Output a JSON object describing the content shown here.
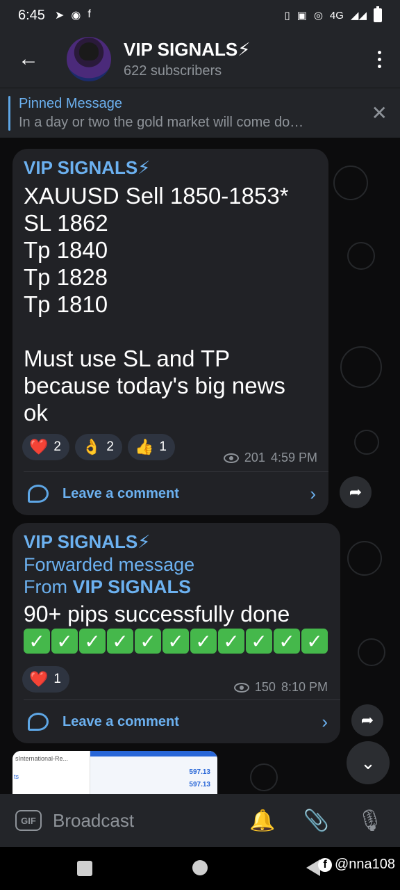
{
  "status_bar": {
    "time": "6:45",
    "left_icons": [
      "telegram-icon",
      "whatsapp-icon",
      "facebook-icon"
    ],
    "right_icons": [
      "vibrate-icon",
      "volte-icon",
      "wifi-calling-icon",
      "signal-icon",
      "battery-icon"
    ],
    "network": "4G"
  },
  "header": {
    "title": "VIP SIGNALS⚡",
    "subtitle": "622 subscribers"
  },
  "pinned": {
    "title": "Pinned Message",
    "text": "In a day or two the gold market will come do…"
  },
  "messages": [
    {
      "sender": "VIP SIGNALS⚡",
      "body": "XAUUSD Sell 1850-1853*\nSL 1862\nTp 1840\nTp 1828\nTp 1810\n\nMust use SL and TP\nbecause today's big news\nok",
      "reactions": [
        {
          "emoji": "❤️",
          "count": "2"
        },
        {
          "emoji": "👌",
          "count": "2"
        },
        {
          "emoji": "👍",
          "count": "1"
        }
      ],
      "views": "201",
      "time": "4:59 PM",
      "comment_label": "Leave a comment"
    },
    {
      "sender": "VIP SIGNALS⚡",
      "forwarded_label": "Forwarded message",
      "from_prefix": "From",
      "from_name": "VIP SIGNALS",
      "body": "90+ pips successfully done",
      "check_count": 11,
      "check_glyph": "✓",
      "reactions": [
        {
          "emoji": "❤️",
          "count": "1"
        }
      ],
      "views": "150",
      "time": "8:10 PM",
      "comment_label": "Leave a comment"
    }
  ],
  "preview": {
    "site": "sInternational-Re...",
    "short": "ts",
    "value1": "597.13",
    "value2": "597.13"
  },
  "input": {
    "gif_label": "GIF",
    "placeholder": "Broadcast"
  },
  "watermark": "@nna108",
  "colors": {
    "accent": "#6cb1f0",
    "bubble": "#212226",
    "header": "#232529",
    "check_green": "#45b84b"
  }
}
